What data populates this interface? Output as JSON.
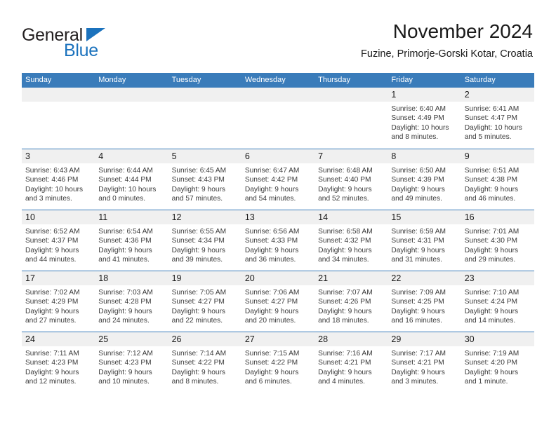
{
  "brand": {
    "word_one": "General",
    "word_two": "Blue"
  },
  "header": {
    "title": "November 2024",
    "subtitle": "Fuzine, Primorje-Gorski Kotar, Croatia"
  },
  "calendar": {
    "weekday_headers": [
      "Sunday",
      "Monday",
      "Tuesday",
      "Wednesday",
      "Thursday",
      "Friday",
      "Saturday"
    ],
    "accent_color": "#3a7cba",
    "daynum_band_color": "#f0f0f0",
    "weeks": [
      [
        {
          "day": "",
          "sunrise": "",
          "sunset": "",
          "daylight_line1": "",
          "daylight_line2": ""
        },
        {
          "day": "",
          "sunrise": "",
          "sunset": "",
          "daylight_line1": "",
          "daylight_line2": ""
        },
        {
          "day": "",
          "sunrise": "",
          "sunset": "",
          "daylight_line1": "",
          "daylight_line2": ""
        },
        {
          "day": "",
          "sunrise": "",
          "sunset": "",
          "daylight_line1": "",
          "daylight_line2": ""
        },
        {
          "day": "",
          "sunrise": "",
          "sunset": "",
          "daylight_line1": "",
          "daylight_line2": ""
        },
        {
          "day": "1",
          "sunrise": "Sunrise: 6:40 AM",
          "sunset": "Sunset: 4:49 PM",
          "daylight_line1": "Daylight: 10 hours",
          "daylight_line2": "and 8 minutes."
        },
        {
          "day": "2",
          "sunrise": "Sunrise: 6:41 AM",
          "sunset": "Sunset: 4:47 PM",
          "daylight_line1": "Daylight: 10 hours",
          "daylight_line2": "and 5 minutes."
        }
      ],
      [
        {
          "day": "3",
          "sunrise": "Sunrise: 6:43 AM",
          "sunset": "Sunset: 4:46 PM",
          "daylight_line1": "Daylight: 10 hours",
          "daylight_line2": "and 3 minutes."
        },
        {
          "day": "4",
          "sunrise": "Sunrise: 6:44 AM",
          "sunset": "Sunset: 4:44 PM",
          "daylight_line1": "Daylight: 10 hours",
          "daylight_line2": "and 0 minutes."
        },
        {
          "day": "5",
          "sunrise": "Sunrise: 6:45 AM",
          "sunset": "Sunset: 4:43 PM",
          "daylight_line1": "Daylight: 9 hours",
          "daylight_line2": "and 57 minutes."
        },
        {
          "day": "6",
          "sunrise": "Sunrise: 6:47 AM",
          "sunset": "Sunset: 4:42 PM",
          "daylight_line1": "Daylight: 9 hours",
          "daylight_line2": "and 54 minutes."
        },
        {
          "day": "7",
          "sunrise": "Sunrise: 6:48 AM",
          "sunset": "Sunset: 4:40 PM",
          "daylight_line1": "Daylight: 9 hours",
          "daylight_line2": "and 52 minutes."
        },
        {
          "day": "8",
          "sunrise": "Sunrise: 6:50 AM",
          "sunset": "Sunset: 4:39 PM",
          "daylight_line1": "Daylight: 9 hours",
          "daylight_line2": "and 49 minutes."
        },
        {
          "day": "9",
          "sunrise": "Sunrise: 6:51 AM",
          "sunset": "Sunset: 4:38 PM",
          "daylight_line1": "Daylight: 9 hours",
          "daylight_line2": "and 46 minutes."
        }
      ],
      [
        {
          "day": "10",
          "sunrise": "Sunrise: 6:52 AM",
          "sunset": "Sunset: 4:37 PM",
          "daylight_line1": "Daylight: 9 hours",
          "daylight_line2": "and 44 minutes."
        },
        {
          "day": "11",
          "sunrise": "Sunrise: 6:54 AM",
          "sunset": "Sunset: 4:36 PM",
          "daylight_line1": "Daylight: 9 hours",
          "daylight_line2": "and 41 minutes."
        },
        {
          "day": "12",
          "sunrise": "Sunrise: 6:55 AM",
          "sunset": "Sunset: 4:34 PM",
          "daylight_line1": "Daylight: 9 hours",
          "daylight_line2": "and 39 minutes."
        },
        {
          "day": "13",
          "sunrise": "Sunrise: 6:56 AM",
          "sunset": "Sunset: 4:33 PM",
          "daylight_line1": "Daylight: 9 hours",
          "daylight_line2": "and 36 minutes."
        },
        {
          "day": "14",
          "sunrise": "Sunrise: 6:58 AM",
          "sunset": "Sunset: 4:32 PM",
          "daylight_line1": "Daylight: 9 hours",
          "daylight_line2": "and 34 minutes."
        },
        {
          "day": "15",
          "sunrise": "Sunrise: 6:59 AM",
          "sunset": "Sunset: 4:31 PM",
          "daylight_line1": "Daylight: 9 hours",
          "daylight_line2": "and 31 minutes."
        },
        {
          "day": "16",
          "sunrise": "Sunrise: 7:01 AM",
          "sunset": "Sunset: 4:30 PM",
          "daylight_line1": "Daylight: 9 hours",
          "daylight_line2": "and 29 minutes."
        }
      ],
      [
        {
          "day": "17",
          "sunrise": "Sunrise: 7:02 AM",
          "sunset": "Sunset: 4:29 PM",
          "daylight_line1": "Daylight: 9 hours",
          "daylight_line2": "and 27 minutes."
        },
        {
          "day": "18",
          "sunrise": "Sunrise: 7:03 AM",
          "sunset": "Sunset: 4:28 PM",
          "daylight_line1": "Daylight: 9 hours",
          "daylight_line2": "and 24 minutes."
        },
        {
          "day": "19",
          "sunrise": "Sunrise: 7:05 AM",
          "sunset": "Sunset: 4:27 PM",
          "daylight_line1": "Daylight: 9 hours",
          "daylight_line2": "and 22 minutes."
        },
        {
          "day": "20",
          "sunrise": "Sunrise: 7:06 AM",
          "sunset": "Sunset: 4:27 PM",
          "daylight_line1": "Daylight: 9 hours",
          "daylight_line2": "and 20 minutes."
        },
        {
          "day": "21",
          "sunrise": "Sunrise: 7:07 AM",
          "sunset": "Sunset: 4:26 PM",
          "daylight_line1": "Daylight: 9 hours",
          "daylight_line2": "and 18 minutes."
        },
        {
          "day": "22",
          "sunrise": "Sunrise: 7:09 AM",
          "sunset": "Sunset: 4:25 PM",
          "daylight_line1": "Daylight: 9 hours",
          "daylight_line2": "and 16 minutes."
        },
        {
          "day": "23",
          "sunrise": "Sunrise: 7:10 AM",
          "sunset": "Sunset: 4:24 PM",
          "daylight_line1": "Daylight: 9 hours",
          "daylight_line2": "and 14 minutes."
        }
      ],
      [
        {
          "day": "24",
          "sunrise": "Sunrise: 7:11 AM",
          "sunset": "Sunset: 4:23 PM",
          "daylight_line1": "Daylight: 9 hours",
          "daylight_line2": "and 12 minutes."
        },
        {
          "day": "25",
          "sunrise": "Sunrise: 7:12 AM",
          "sunset": "Sunset: 4:23 PM",
          "daylight_line1": "Daylight: 9 hours",
          "daylight_line2": "and 10 minutes."
        },
        {
          "day": "26",
          "sunrise": "Sunrise: 7:14 AM",
          "sunset": "Sunset: 4:22 PM",
          "daylight_line1": "Daylight: 9 hours",
          "daylight_line2": "and 8 minutes."
        },
        {
          "day": "27",
          "sunrise": "Sunrise: 7:15 AM",
          "sunset": "Sunset: 4:22 PM",
          "daylight_line1": "Daylight: 9 hours",
          "daylight_line2": "and 6 minutes."
        },
        {
          "day": "28",
          "sunrise": "Sunrise: 7:16 AM",
          "sunset": "Sunset: 4:21 PM",
          "daylight_line1": "Daylight: 9 hours",
          "daylight_line2": "and 4 minutes."
        },
        {
          "day": "29",
          "sunrise": "Sunrise: 7:17 AM",
          "sunset": "Sunset: 4:21 PM",
          "daylight_line1": "Daylight: 9 hours",
          "daylight_line2": "and 3 minutes."
        },
        {
          "day": "30",
          "sunrise": "Sunrise: 7:19 AM",
          "sunset": "Sunset: 4:20 PM",
          "daylight_line1": "Daylight: 9 hours",
          "daylight_line2": "and 1 minute."
        }
      ]
    ]
  }
}
